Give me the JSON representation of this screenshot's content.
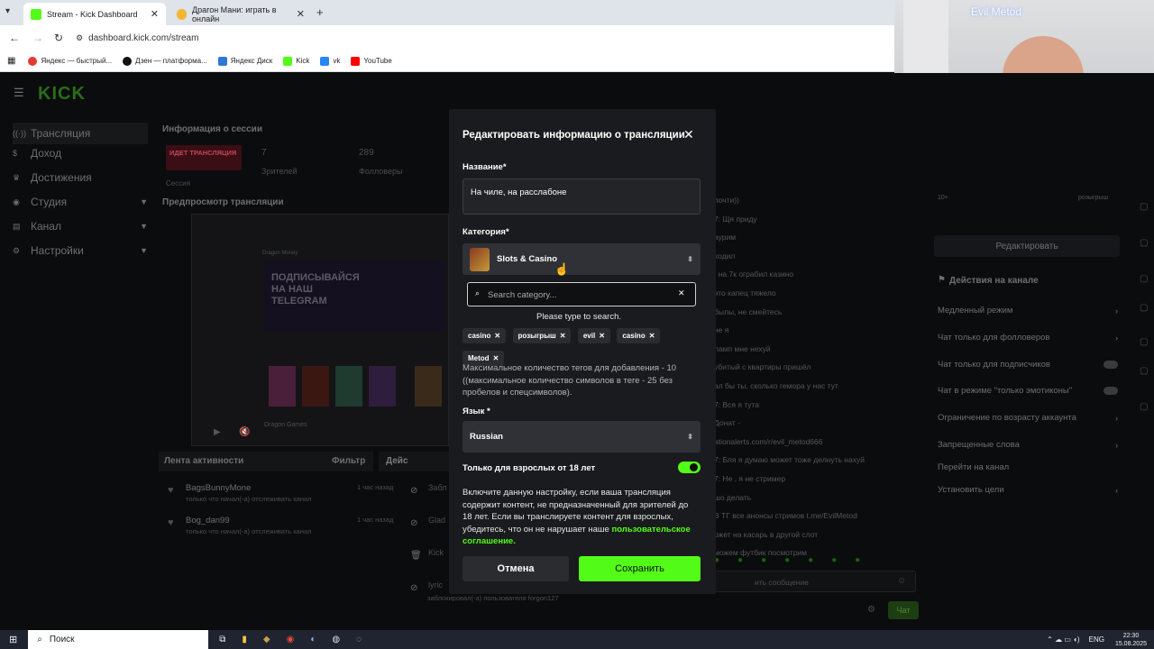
{
  "browser": {
    "tabs": [
      {
        "title": "Stream - Kick Dashboard",
        "active": true
      },
      {
        "title": "Драгон Мани: играть в онлайн",
        "active": false
      }
    ],
    "new_tab": "+",
    "url": "dashboard.kick.com/stream",
    "bookmarks": [
      "Яндекс — быстрый...",
      "Дзен — платформа...",
      "Яндекс Диск",
      "Kick",
      "vk",
      "YouTube"
    ]
  },
  "webcam": {
    "overlay_text": "Evil Metod"
  },
  "sidebar": {
    "logo": "KICK",
    "items": [
      {
        "label": "Трансляция",
        "icon": "broadcast-icon"
      },
      {
        "label": "Доход",
        "icon": "dollar-icon"
      },
      {
        "label": "Достижения",
        "icon": "trophy-icon"
      },
      {
        "label": "Студия",
        "icon": "studio-icon"
      },
      {
        "label": "Канал",
        "icon": "channel-icon"
      },
      {
        "label": "Настройки",
        "icon": "gear-icon"
      }
    ]
  },
  "session": {
    "title": "Информация о сессии",
    "live_badge": "ИДЕТ ТРАНСЛЯЦИЯ",
    "viewers_value": "7",
    "viewers_label": "Зрителей",
    "followers_value": "289",
    "followers_label": "Фолловеры",
    "session_label": "Сессия"
  },
  "preview": {
    "title": "Предпросмотр трансляции",
    "stream_heading": "ПОДПИСЫВАЙСЯ НА НАШ TELEGRAM",
    "stream_sub": "Dragon Money",
    "games_label": "Dragon Games"
  },
  "activity": {
    "title": "Лента активности",
    "filter": "Фильтр",
    "entries": [
      {
        "user": "BagsBunnyMone",
        "time": "1 час назад",
        "text": "только что начал(-а) отслеживать канал"
      },
      {
        "user": "Bog_dan99",
        "time": "1 час назад",
        "text": "только что начал(-а) отслеживать канал"
      }
    ],
    "footer": "заблокировал(-а) пользователя forgon127"
  },
  "actions_partial": {
    "title": "Дейс",
    "rows": [
      "Забл",
      "Glad",
      "Kick",
      "lyric"
    ]
  },
  "chat": {
    "lines": [
      "почти))",
      "7: Щя приду",
      "аурим",
      "ходил",
      ", на 7к ограбил казино",
      "это капец тяжело",
      "былы, не смейтесь",
      "не я",
      "ламп мне нехуй",
      "убитый с квартиры пришёл",
      "ал бы ты, сколько гемора у нас тут",
      "7: Вся я тута",
      "Донат -",
      "ationalerts.com/r/evil_metod666",
      "7: Бля я думаю может тоже делнуть нахуй",
      "7: Не , я не стример",
      "шо делать",
      "В ТГ все анонсы стримов t.me/EvilMetod",
      "ожет на касарь в другой слот",
      "можем футбик посмотрим",
      "Цельный бонус попроси у поддержки"
    ],
    "input_placeholder": "ить сообщение",
    "send": "Чат"
  },
  "moderation": {
    "edit": "Редактировать",
    "title": "Действия на канале",
    "items": [
      {
        "label": "Медленный режим",
        "type": "chevron"
      },
      {
        "label": "Чат только для фолловеров",
        "type": "chevron"
      },
      {
        "label": "Чат только для подписчиков",
        "type": "toggle"
      },
      {
        "label": "Чат в режиме \"только эмотиконы\"",
        "type": "toggle"
      },
      {
        "label": "Ограничение по возрасту аккаунта",
        "type": "chevron"
      },
      {
        "label": "Запрещенные слова",
        "type": "chevron"
      },
      {
        "label": "Перейти на канал",
        "type": "none"
      },
      {
        "label": "Установить цели",
        "type": "chevron"
      }
    ],
    "top_stats": [
      "10+",
      "розыгрыш"
    ]
  },
  "modal": {
    "title": "Редактировать информацию о трансляции",
    "name_label": "Название*",
    "name_value": "На чиле, на расслабоне",
    "category_label": "Категория*",
    "category_value": "Slots & Casino",
    "search_placeholder": "Search category...",
    "search_hint": "Please type to search.",
    "tags": [
      "casino",
      "розыгрыш",
      "evil",
      "casino",
      "Metod"
    ],
    "tags_note": "Максимальное количество тегов для добавления - 10 ((максимальное количество символов в теге - 25 без пробелов и спецсимволов).",
    "language_label": "Язык *",
    "language_value": "Russian",
    "adult_label": "Только для взрослых от 18 лет",
    "adult_on": true,
    "adult_desc": "Включите данную настройку, если ваша трансляция содержит контент, не предназначенный для зрителей до 18 лет. Если вы транслируете контент для взрослых, убедитесь, что он не нарушает наше",
    "agreement_link": "пользовательское соглашение.",
    "cancel": "Отмена",
    "save": "Сохранить"
  },
  "taskbar": {
    "search": "Поиск",
    "lang": "ENG",
    "time": "22:30",
    "date": "15.08.2025"
  },
  "colors": {
    "kick_green": "#53fc18",
    "live_red": "#e0253a",
    "modal_bg": "#1a1b1e"
  }
}
